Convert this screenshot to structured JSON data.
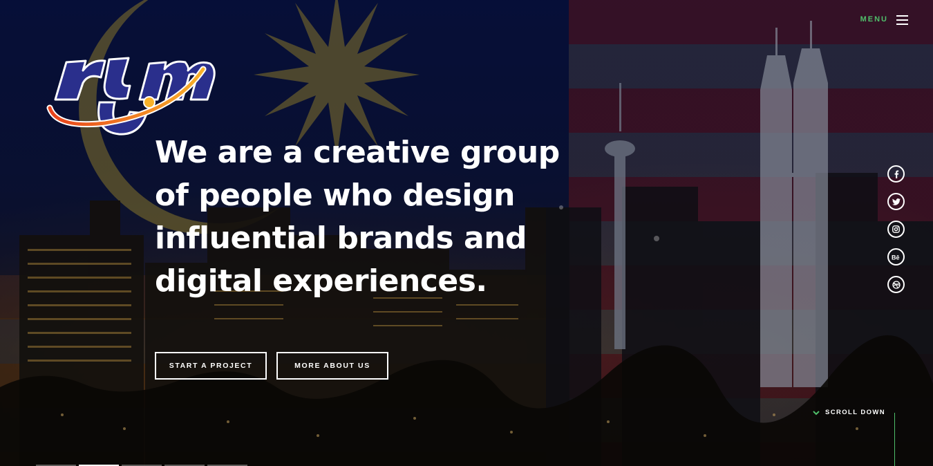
{
  "header": {
    "menu_label": "MENU"
  },
  "hero": {
    "headline_lines": [
      "We are a creative group",
      "of people who design",
      "influential brands and",
      "digital experiences."
    ]
  },
  "buttons": {
    "start_project": "START A PROJECT",
    "more_about": "MORE ABOUT US"
  },
  "social": [
    {
      "icon": "facebook-icon"
    },
    {
      "icon": "twitter-icon"
    },
    {
      "icon": "instagram-icon"
    },
    {
      "icon": "behance-icon"
    },
    {
      "icon": "dribbble-icon"
    }
  ],
  "scroll": {
    "label": "SCROLL DOWN"
  },
  "colors": {
    "accent_green": "#4fbf6a",
    "text_white": "#ffffff",
    "logo_blue": "#2a2f8c",
    "logo_orange": "#f08a1c"
  }
}
